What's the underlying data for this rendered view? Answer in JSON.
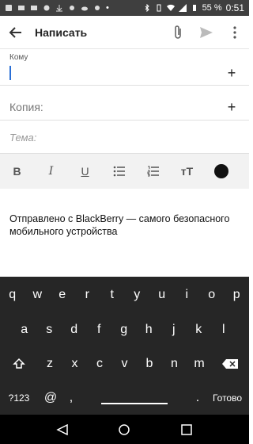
{
  "status_bar": {
    "battery": "55 %",
    "time": "0:51"
  },
  "app_bar": {
    "title": "Написать"
  },
  "compose": {
    "to_label": "Кому",
    "cc_label": "Копия:",
    "subject_placeholder": "Тема:",
    "plus_symbol": "+",
    "body": "Отправлено с BlackBerry — самого безопасного мобильного устройства"
  },
  "format_bar": {
    "bold": "B",
    "italic": "I",
    "underline": "U",
    "text_size": "тТ"
  },
  "keyboard": {
    "row1": [
      "q",
      "w",
      "e",
      "r",
      "t",
      "y",
      "u",
      "i",
      "o",
      "p"
    ],
    "row2": [
      "a",
      "s",
      "d",
      "f",
      "g",
      "h",
      "j",
      "k",
      "l"
    ],
    "row3": [
      "z",
      "x",
      "c",
      "v",
      "b",
      "n",
      "m"
    ],
    "symbols_key": "?123",
    "at_key": "@",
    "comma_key": ",",
    "period_key": ".",
    "done_key": "Готово"
  }
}
